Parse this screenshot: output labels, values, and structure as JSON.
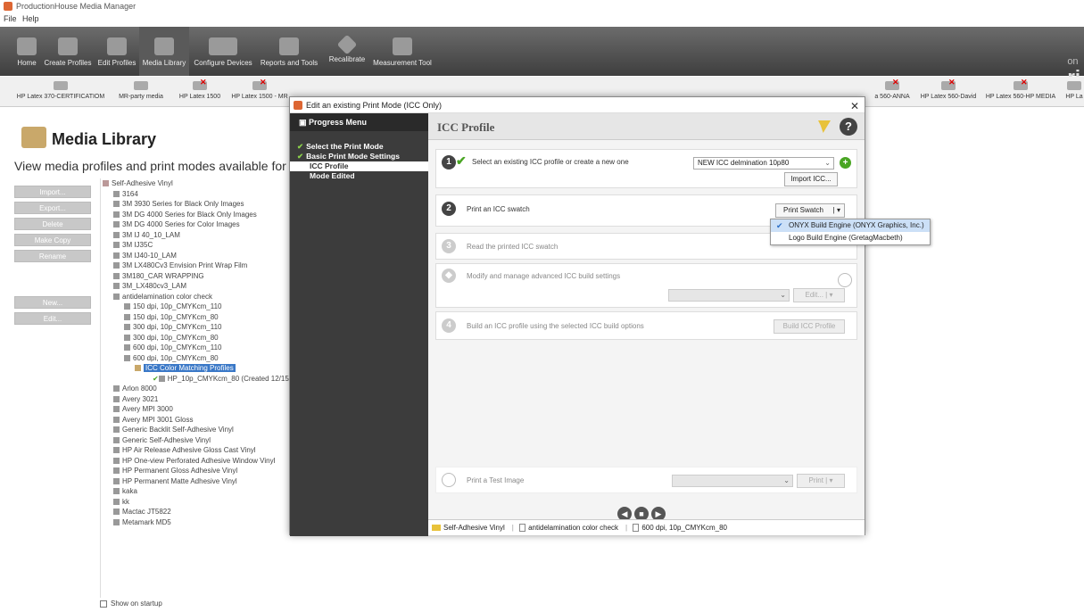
{
  "app": {
    "title": "ProductionHouse Media Manager",
    "menu": [
      "File",
      "Help"
    ]
  },
  "toolbar": {
    "items": [
      "Home",
      "Create Profiles",
      "Edit Profiles",
      "Media Library",
      "Configure Devices",
      "Reports and Tools",
      "Recalibrate",
      "Measurement Tool"
    ]
  },
  "devices": [
    "HP Latex 370-CERTIFICATIOM",
    "MR-party media",
    "HP Latex 1500",
    "HP Latex 1500 - MR",
    "a 560-ANNA",
    "HP Latex 560-David",
    "HP Latex 560-HP MEDIA",
    "HP La"
  ],
  "media_library": {
    "title": "Media Library",
    "subtitle": "View media profiles and print modes available for yo",
    "buttons": [
      "Import...",
      "Export...",
      "Delete",
      "Make Copy",
      "Rename",
      "New...",
      "Edit..."
    ],
    "tree": [
      "Self-Adhesive Vinyl",
      "3164",
      "3M 3930 Series for Black Only Images",
      "3M DG 4000 Series for Black Only Images",
      "3M DG 4000 Series for Color Images",
      "3M IJ 40_10_LAM",
      "3M IJ35C",
      "3M IJ40-10_LAM",
      "3M LX480Cv3 Envision Print Wrap Film",
      "3M180_CAR WRAPPING",
      "3M_LX480cv3_LAM",
      "antidelamination color check",
      "150 dpi, 10p_CMYKcm_110",
      "150 dpi, 10p_CMYKcm_80",
      "300 dpi, 10p_CMYKcm_110",
      "300 dpi, 10p_CMYKcm_80",
      "600 dpi, 10p_CMYKcm_110",
      "600 dpi, 10p_CMYKcm_80",
      "ICC Color Matching Profiles",
      "HP_10p_CMYKcm_80 (Created 12/15/08",
      "Arlon 8000",
      "Avery 3021",
      "Avery MPI 3000",
      "Avery MPI 3001 Gloss",
      "Generic Backlit Self-Adhesive Vinyl",
      "Generic Self-Adhesive Vinyl",
      "HP Air Release Adhesive Gloss Cast Vinyl",
      "HP One-view Perforated Adhesive Window Vinyl",
      "HP Permanent Gloss Adhesive Vinyl",
      "HP Permanent Matte Adhesive Vinyl",
      "kaka",
      "kk",
      "Mactac JT5822",
      "Metamark MD5"
    ],
    "show_on_startup": "Show on startup"
  },
  "dialog": {
    "title": "Edit an existing Print Mode (ICC Only)",
    "progress_head": "Progress Menu",
    "progress": [
      "Select the Print Mode",
      "Basic Print Mode Settings",
      "ICC Profile",
      "Mode Edited"
    ],
    "panel_title": "ICC Profile",
    "step1": {
      "num": "1",
      "text": "Select an existing ICC profile or create a new one",
      "combo": "NEW ICC delmination 10p80",
      "button": "Import ICC..."
    },
    "step2": {
      "num": "2",
      "text": "Print an ICC swatch",
      "button": "Print Swatch"
    },
    "step3": {
      "num": "3",
      "text": "Read the printed ICC swatch"
    },
    "step4": {
      "text": "Modify and manage advanced ICC build settings",
      "button": "Edit..."
    },
    "step5": {
      "num": "4",
      "text": "Build an ICC profile using the selected ICC build options",
      "button": "Build ICC Profile"
    },
    "step6": {
      "text": "Print a Test Image",
      "button": "Print"
    },
    "dropdown": [
      "ONYX Build Engine (ONYX Graphics, Inc.)",
      "Logo Build Engine (GretagMacbeth)"
    ],
    "status": [
      "Self-Adhesive Vinyl",
      "antidelamination color check",
      "600 dpi, 10p_CMYKcm_80"
    ]
  }
}
